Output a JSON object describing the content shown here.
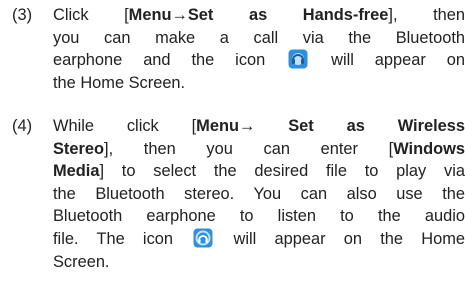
{
  "step3": {
    "number": "(3)",
    "l1_a": "Click [",
    "l1_b": "Menu→Set as Hands-free",
    "l1_c": "], then",
    "l2": "you can make a call via the Bluetooth",
    "l3_a": "earphone and the icon",
    "l3_b": "will appear on",
    "l4": "the Home Screen.",
    "icon_name": "bluetooth-headset-icon"
  },
  "step4": {
    "number": "(4)",
    "l1_a": "While click [",
    "l1_b": "Menu→ Set as Wireless",
    "l2_a": "Stereo",
    "l2_b": "], then you can enter [",
    "l2_c": "Windows",
    "l3_a": "Media",
    "l3_b": "] to select the desired file to play via",
    "l4": "the Bluetooth stereo. You can also use the",
    "l5": "Bluetooth earphone to listen to the audio",
    "l6_a": "file. The icon",
    "l6_b": "will appear on the Home",
    "l7": "Screen.",
    "icon_name": "bluetooth-stereo-icon"
  },
  "colors": {
    "icon_blue": "#2f8fd8",
    "icon_light": "#bfe3ff",
    "text": "#222222"
  }
}
